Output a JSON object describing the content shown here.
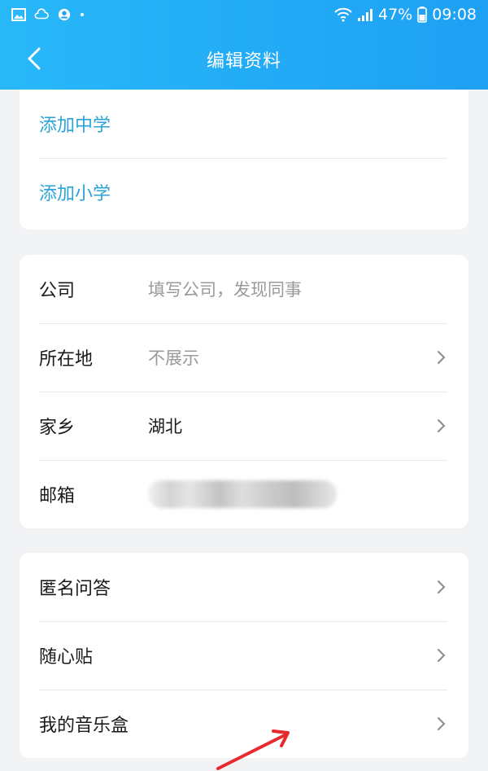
{
  "status_bar": {
    "battery": "47%",
    "time": "09:08"
  },
  "nav": {
    "title": "编辑资料"
  },
  "education": {
    "items": [
      {
        "label": "添加中学"
      },
      {
        "label": "添加小学"
      }
    ]
  },
  "info": {
    "company": {
      "label": "公司",
      "placeholder": "填写公司，发现同事"
    },
    "location": {
      "label": "所在地",
      "value": "不展示"
    },
    "hometown": {
      "label": "家乡",
      "value": "湖北"
    },
    "email": {
      "label": "邮箱"
    }
  },
  "more": {
    "items": [
      {
        "label": "匿名问答"
      },
      {
        "label": "随心贴"
      },
      {
        "label": "我的音乐盒"
      }
    ]
  },
  "colors": {
    "header": "#1ea0f4",
    "link": "#2aa4d8",
    "annotation_arrow": "#e8292d"
  },
  "icons": [
    "gallery-icon",
    "cloud-icon",
    "account-icon",
    "wifi-icon",
    "signal-icon",
    "battery-icon",
    "back-arrow-icon",
    "chevron-right-icon"
  ]
}
